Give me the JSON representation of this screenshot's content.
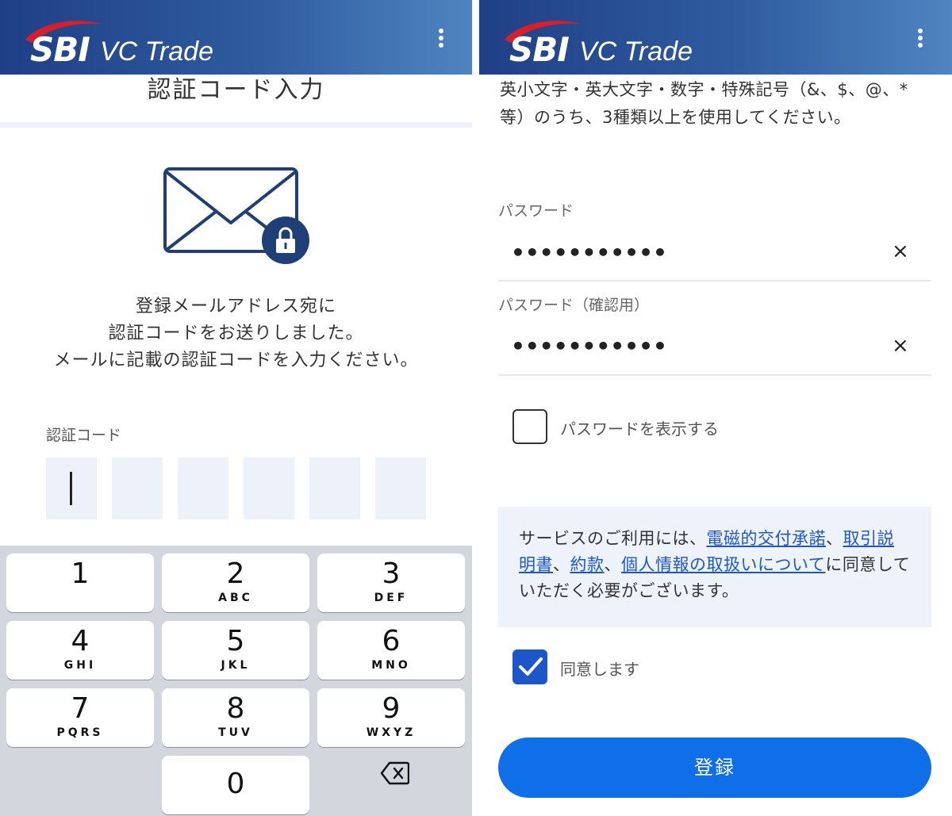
{
  "header": {
    "logo_sbi": "SBI",
    "logo_text": "VC Trade",
    "menu_icon": "more-vertical-icon"
  },
  "colors": {
    "header_start": "#1f3f87",
    "header_end": "#4f84c1",
    "accent": "#0f6fe8",
    "link": "#1d56c9"
  },
  "verify": {
    "title": "認証コード入力",
    "instruction_lines": [
      "登録メールアドレス宛に",
      "認証コードをお送りしました。",
      "メールに記載の認証コードを入力ください。"
    ],
    "code_label": "認証コード",
    "code_values": [
      "",
      "",
      "",
      "",
      "",
      ""
    ]
  },
  "keypad": {
    "keys": [
      {
        "num": "1",
        "letters": ""
      },
      {
        "num": "2",
        "letters": "ABC"
      },
      {
        "num": "3",
        "letters": "DEF"
      },
      {
        "num": "4",
        "letters": "GHI"
      },
      {
        "num": "5",
        "letters": "JKL"
      },
      {
        "num": "6",
        "letters": "MNO"
      },
      {
        "num": "7",
        "letters": "PQRS"
      },
      {
        "num": "8",
        "letters": "TUV"
      },
      {
        "num": "9",
        "letters": "WXYZ"
      },
      {
        "num": "0",
        "letters": ""
      }
    ],
    "delete_icon": "backspace-icon"
  },
  "password": {
    "rules_text": "英小文字・英大文字・数字・特殊記号（&、$、@、*等）のうち、3種類以上を使用してください。",
    "password_label": "パスワード",
    "password_value": "•••••••••••",
    "confirm_label": "パスワード（確認用）",
    "confirm_value": "•••••••••••",
    "clear_symbol": "×",
    "show_password_label": "パスワードを表示する",
    "show_password_checked": false,
    "notice": {
      "prefix": "サービスのご利用には、",
      "link1": "電磁的交付承諾",
      "sep1": "、",
      "link2": "取引説明書",
      "sep2": "、",
      "link3": "約款",
      "sep3": "、",
      "link4": "個人情報の取扱いについて",
      "suffix": "に同意していただく必要がございます。"
    },
    "agree_label": "同意します",
    "agree_checked": true,
    "submit_label": "登録"
  }
}
